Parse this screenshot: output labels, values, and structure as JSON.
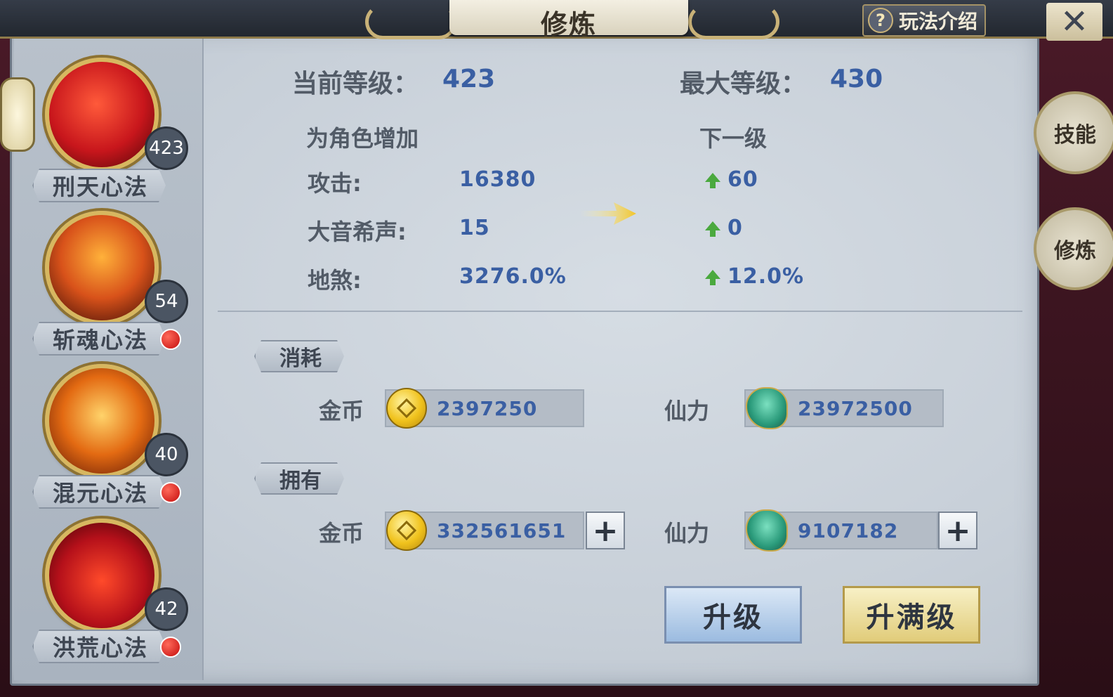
{
  "window": {
    "title": "修炼",
    "help_label": "玩法介绍",
    "close_label": "✕"
  },
  "side_tabs": [
    {
      "label": "技能"
    },
    {
      "label": "修炼"
    }
  ],
  "skills": [
    {
      "name": "刑天心法",
      "level": "423",
      "has_dot": false,
      "color": "#c8161c"
    },
    {
      "name": "斩魂心法",
      "level": "54",
      "has_dot": true,
      "color": "#d8521a"
    },
    {
      "name": "混元心法",
      "level": "40",
      "has_dot": true,
      "color": "#e36a12"
    },
    {
      "name": "洪荒心法",
      "level": "42",
      "has_dot": true,
      "color": "#b5101a"
    }
  ],
  "levels": {
    "current_label": "当前等级：",
    "current_value": "423",
    "max_label": "最大等级：",
    "max_value": "430"
  },
  "stats": {
    "add_header": "为角色增加",
    "next_header": "下一级",
    "rows": [
      {
        "label": "攻击:",
        "value": "16380",
        "next": "60"
      },
      {
        "label": "大音希声:",
        "value": "15",
        "next": "0"
      },
      {
        "label": "地煞:",
        "value": "3276.0%",
        "next": "12.0%"
      }
    ]
  },
  "cost": {
    "tag": "消耗",
    "gold_label": "金币",
    "gold_value": "2397250",
    "power_label": "仙力",
    "power_value": "23972500"
  },
  "owned": {
    "tag": "拥有",
    "gold_label": "金币",
    "gold_value": "332561651",
    "power_label": "仙力",
    "power_value": "9107182",
    "plus": "+"
  },
  "buttons": {
    "upgrade": "升级",
    "upgrade_max": "升满级"
  },
  "colors": {
    "value_blue": "#3a5fa3",
    "up_green": "#4aa93e",
    "gold_accent": "#d7b760"
  }
}
